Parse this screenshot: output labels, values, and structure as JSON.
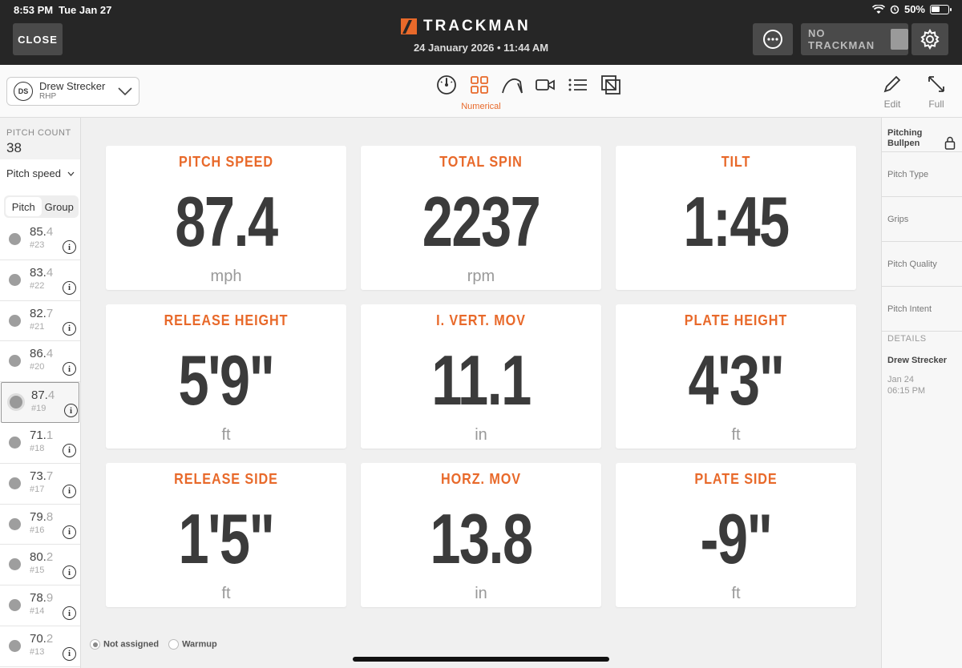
{
  "status": {
    "time": "8:53 PM",
    "day": "Tue Jan 27",
    "battery": "50%"
  },
  "header": {
    "close_label": "CLOSE",
    "brand": "TRACKMAN",
    "session_date": "24 January 2026 • 11:44 AM",
    "no_trackman_label": "NO TRACKMAN",
    "brand_color": "#e8692a"
  },
  "player": {
    "initials": "DS",
    "name": "Drew Strecker",
    "role": "RHP"
  },
  "views": {
    "icons": [
      "gauge-icon",
      "grid-icon",
      "trajectory-icon",
      "video-icon",
      "list-icon",
      "layers-icon"
    ],
    "active_label": "Numerical"
  },
  "tools": {
    "edit_label": "Edit",
    "full_label": "Full"
  },
  "sidebar": {
    "pitch_count_label": "PITCH COUNT",
    "pitch_count": "38",
    "metric": "Pitch speed",
    "tabs": [
      "Pitch",
      "Group"
    ],
    "pitches": [
      {
        "whole": "85.",
        "dec": "4",
        "num": "#23"
      },
      {
        "whole": "83.",
        "dec": "4",
        "num": "#22"
      },
      {
        "whole": "82.",
        "dec": "7",
        "num": "#21"
      },
      {
        "whole": "86.",
        "dec": "4",
        "num": "#20"
      },
      {
        "whole": "87.",
        "dec": "4",
        "num": "#19"
      },
      {
        "whole": "71.",
        "dec": "1",
        "num": "#18"
      },
      {
        "whole": "73.",
        "dec": "7",
        "num": "#17"
      },
      {
        "whole": "79.",
        "dec": "8",
        "num": "#16"
      },
      {
        "whole": "80.",
        "dec": "2",
        "num": "#15"
      },
      {
        "whole": "78.",
        "dec": "9",
        "num": "#14"
      },
      {
        "whole": "70.",
        "dec": "2",
        "num": "#13"
      }
    ],
    "selected_index": 4
  },
  "cards": [
    {
      "title": "PITCH SPEED",
      "value": "87.4",
      "unit": "mph"
    },
    {
      "title": "TOTAL SPIN",
      "value": "2237",
      "unit": "rpm"
    },
    {
      "title": "TILT",
      "value": "1:45",
      "unit": ""
    },
    {
      "title": "RELEASE HEIGHT",
      "value": "5'9\"",
      "unit": "ft"
    },
    {
      "title": "I. VERT. MOV",
      "value": "11.1",
      "unit": "in"
    },
    {
      "title": "PLATE HEIGHT",
      "value": "4'3\"",
      "unit": "ft"
    },
    {
      "title": "RELEASE SIDE",
      "value": "1'5\"",
      "unit": "ft"
    },
    {
      "title": "HORZ. MOV",
      "value": "13.8",
      "unit": "in"
    },
    {
      "title": "PLATE SIDE",
      "value": "-9\"",
      "unit": "ft"
    }
  ],
  "assignment": {
    "options": [
      "Not assigned",
      "Warmup"
    ],
    "selected": "Not assigned"
  },
  "right_panel": {
    "header": "Pitching Bullpen",
    "items": [
      "Pitch Type",
      "Grips",
      "Pitch Quality",
      "Pitch Intent"
    ],
    "details_label": "DETAILS",
    "details_name": "Drew Strecker",
    "details_date": "Jan 24",
    "details_time": "06:15 PM"
  }
}
